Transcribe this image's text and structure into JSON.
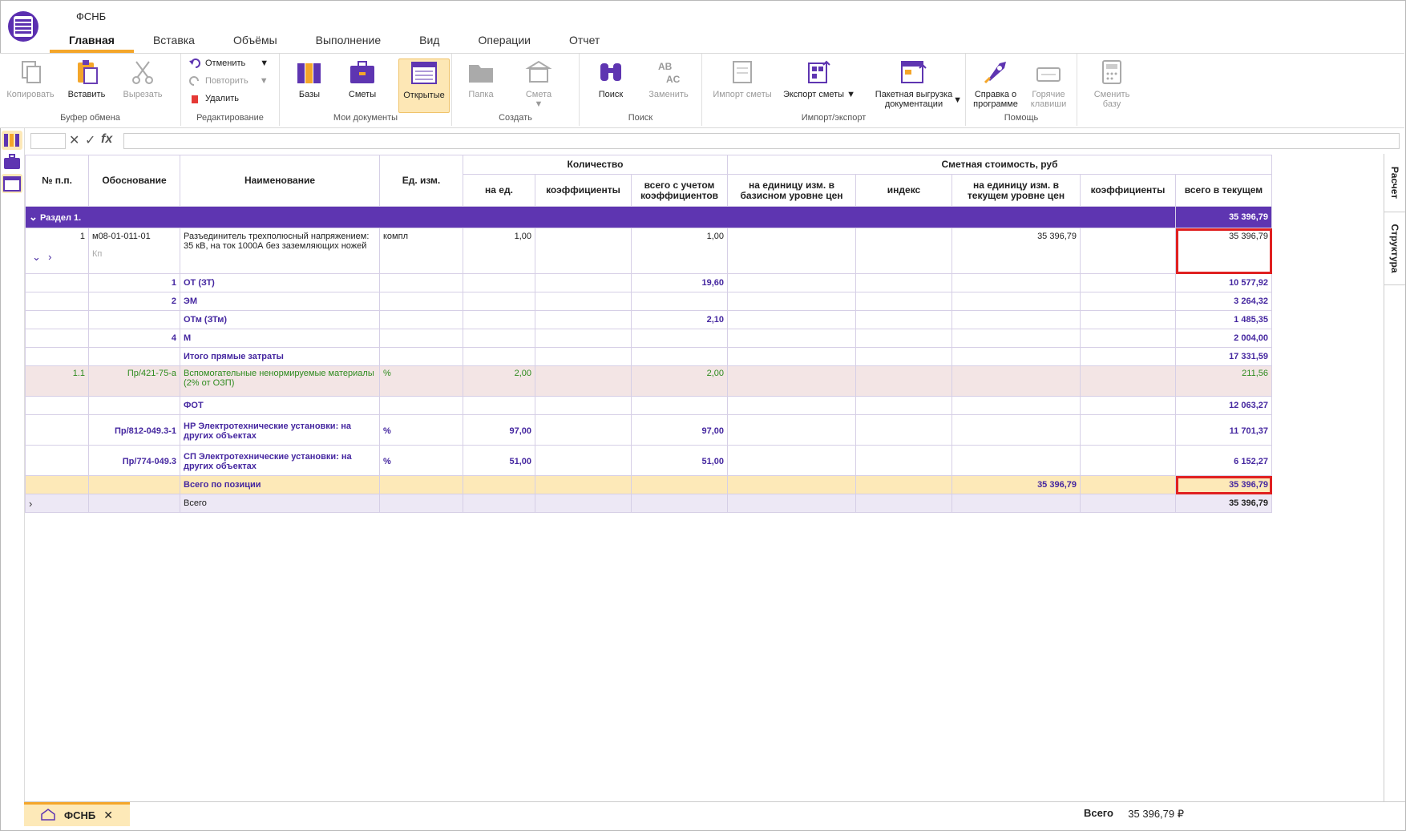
{
  "app": {
    "title": "ФСНБ"
  },
  "tabs": [
    "Главная",
    "Вставка",
    "Объёмы",
    "Выполнение",
    "Вид",
    "Операции",
    "Отчет"
  ],
  "ribbon": {
    "clipboard": {
      "label": "Буфер обмена",
      "copy": "Копировать",
      "paste": "Вставить",
      "cut": "Вырезать"
    },
    "edit": {
      "label": "Редактирование",
      "undo": "Отменить",
      "redo": "Повторить",
      "delete": "Удалить"
    },
    "docs": {
      "label": "Мои документы",
      "bases": "Базы",
      "estimates": "Сметы",
      "open": "Открытые"
    },
    "create": {
      "label": "Создать",
      "folder": "Папка",
      "estimate": "Смета"
    },
    "search": {
      "label": "Поиск",
      "find": "Поиск",
      "replace": "Заменить"
    },
    "io": {
      "label": "Импорт/экспорт",
      "import": "Импорт сметы",
      "export": "Экспорт сметы",
      "batch": "Пакетная выгрузка документации"
    },
    "help": {
      "label": "Помощь",
      "about": "Справка о программе",
      "hotkeys": "Горячие клавиши"
    },
    "switch": {
      "label": "Сменить базу"
    }
  },
  "formula": {
    "fx": "fx"
  },
  "side_tabs": [
    "Расчет",
    "Структура"
  ],
  "table": {
    "headers": {
      "num": "№ п.п.",
      "basis": "Обоснование",
      "name": "Наименование",
      "unit": "Ед. изм.",
      "qty": "Количество",
      "qty_per": "на ед.",
      "qty_coef": "коэффициенты",
      "qty_total": "всего с учетом коэффициентов",
      "cost": "Сметная стоимость, руб",
      "cost_base": "на единицу изм. в базисном уровне цен",
      "cost_index": "индекс",
      "cost_current": "на единицу изм. в текущем уровне цен",
      "cost_coef": "коэффициенты",
      "cost_total": "всего в текущем"
    },
    "section": {
      "title": "Раздел 1.",
      "total": "35 396,79"
    },
    "main": {
      "num": "1",
      "basis": "м08-01-011-01",
      "kp": "Кп",
      "name": "Разъединитель трехполюсный напряжением: 35 кВ, на ток 1000А без заземляющих ножей",
      "unit": "компл",
      "qty_per": "1,00",
      "qty_total": "1,00",
      "cost_current": "35 396,79",
      "total": "35 396,79"
    },
    "subs": [
      {
        "num": "1",
        "name": "ОТ (ЗТ)",
        "qty_total": "19,60",
        "total": "10 577,92"
      },
      {
        "num": "2",
        "name": "ЭМ",
        "qty_total": "",
        "total": "3 264,32"
      },
      {
        "num": "",
        "name": "ОТм (ЗТм)",
        "qty_total": "2,10",
        "total": "1 485,35"
      },
      {
        "num": "4",
        "name": "М",
        "qty_total": "",
        "total": "2 004,00"
      },
      {
        "num": "",
        "name": "Итого прямые затраты",
        "qty_total": "",
        "total": "17 331,59"
      }
    ],
    "aux": {
      "num": "1.1",
      "basis": "Пр/421-75-а",
      "name": "Вспомогательные ненормируемые материалы (2% от ОЗП)",
      "unit": "%",
      "qty_per": "2,00",
      "qty_total": "2,00",
      "total": "211,56"
    },
    "fot": {
      "name": "ФОТ",
      "total": "12 063,27"
    },
    "nr": {
      "basis": "Пр/812-049.3-1",
      "name": "НР Электротехнические установки: на других объектах",
      "unit": "%",
      "qty_per": "97,00",
      "qty_total": "97,00",
      "total": "11 701,37"
    },
    "sp": {
      "basis": "Пр/774-049.3",
      "name": "СП Электротехнические установки: на других объектах",
      "unit": "%",
      "qty_per": "51,00",
      "qty_total": "51,00",
      "total": "6 152,27"
    },
    "position": {
      "name": "Всего по позиции",
      "cost_current": "35 396,79",
      "total": "35 396,79"
    },
    "grand": {
      "name": "Всего",
      "total": "35 396,79"
    }
  },
  "bottom": {
    "doc_tab": "ФСНБ",
    "sum_label": "Всего",
    "sum_value": "35 396,79 ₽"
  },
  "colors": {
    "accent": "#5e35b1",
    "highlight": "#f4a62a",
    "red_frame": "#e02020"
  }
}
